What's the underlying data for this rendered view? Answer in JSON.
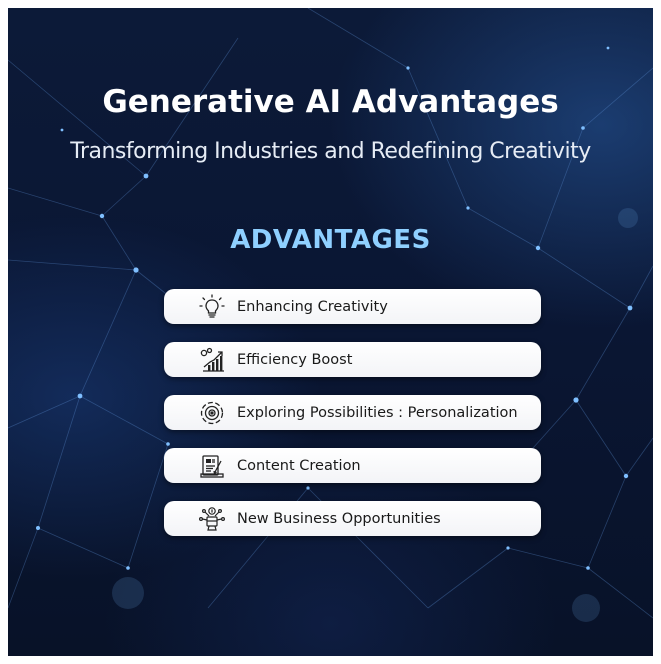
{
  "header": {
    "title": "Generative AI Advantages",
    "subtitle": "Transforming Industries and Redefining Creativity"
  },
  "section": {
    "heading": "ADVANTAGES"
  },
  "advantages": [
    {
      "label": "Enhancing Creativity",
      "icon": "lightbulb-icon"
    },
    {
      "label": "Efficiency Boost",
      "icon": "gears-chart-icon"
    },
    {
      "label": "Exploring Possibilities : Personalization",
      "icon": "target-circle-icon"
    },
    {
      "label": "Content Creation",
      "icon": "document-pen-icon"
    },
    {
      "label": "New Business Opportunities",
      "icon": "network-money-icon"
    }
  ],
  "colors": {
    "background": "#0a1633",
    "heading_accent": "#8fd0ff",
    "card_background": "#ffffff",
    "card_text": "#1a1a1a"
  }
}
